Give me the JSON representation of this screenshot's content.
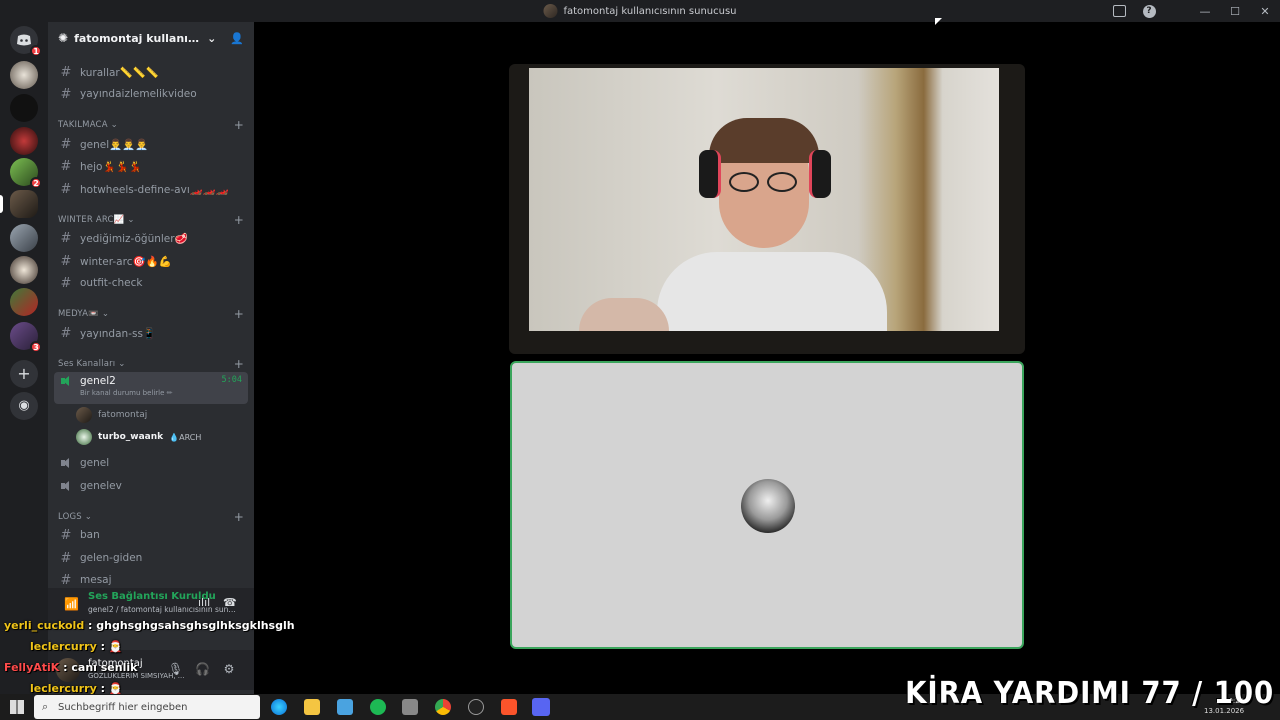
{
  "window": {
    "title": "fatomontaj kullanıcısının sunucusu"
  },
  "server": {
    "name": "fatomontaj kullanıcısının..."
  },
  "rail": {
    "badges": [
      "1",
      "2",
      "3"
    ]
  },
  "channels_top": [
    {
      "name": "kurallar📏📏📏"
    },
    {
      "name": "yayındaizlemelikvideo"
    }
  ],
  "categories": {
    "takilmaca": "TAKILMACA",
    "winter_arc": "WINTER ARC📈",
    "medya": "MEDYA📼",
    "ses": "Ses Kanalları",
    "logs": "LOGS"
  },
  "takilmaca_channels": [
    "genel👨‍💼👨‍💼👨‍💼",
    "hejo💃💃💃",
    "hotwheels-define-avı🏎️🏎️🏎️"
  ],
  "winter_channels": [
    "yediğimiz-öğünler🥩",
    "winter-arc🎯🔥💪",
    "outfit-check"
  ],
  "medya_channels": [
    "yayından-ss📱"
  ],
  "voice": {
    "active": {
      "name": "genel2",
      "time": "5:04",
      "status": "Bir kanal durumu belirle ✏"
    },
    "users": [
      {
        "name": "fatomontaj",
        "tag": ""
      },
      {
        "name": "turbo_waank",
        "tag": "💧ARCH"
      }
    ],
    "others": [
      "genel",
      "genelev"
    ]
  },
  "logs_channels": [
    "ban",
    "gelen-giden",
    "mesaj"
  ],
  "vpanel": {
    "title": "Ses Bağlantısı Kuruldu",
    "sub": "genel2 / fatomontaj kullanıcısının sunucu..."
  },
  "user": {
    "name": "fatomontaj",
    "status": "GOZLUKLERIM SIMSIYAH, ..."
  },
  "chat": [
    {
      "user": "yerli_cuckold",
      "msg": ": ghghsghgsahsghsglhksgklhsglh"
    },
    {
      "user": "leclercurry",
      "msg": ": 🎅"
    },
    {
      "user": "FellyAtiK",
      "msg": ": canı senlik"
    },
    {
      "user": "leclercurry",
      "msg": ": 🎅"
    },
    {
      "user": "leclercurry",
      "msg": ""
    }
  ],
  "taskbar": {
    "search_placeholder": "Suchbegriff hier eingeben",
    "time": "20:25",
    "date": "13.01.2026"
  },
  "overlay": {
    "kira": "KİRA YARDIMI 77 / 100"
  }
}
